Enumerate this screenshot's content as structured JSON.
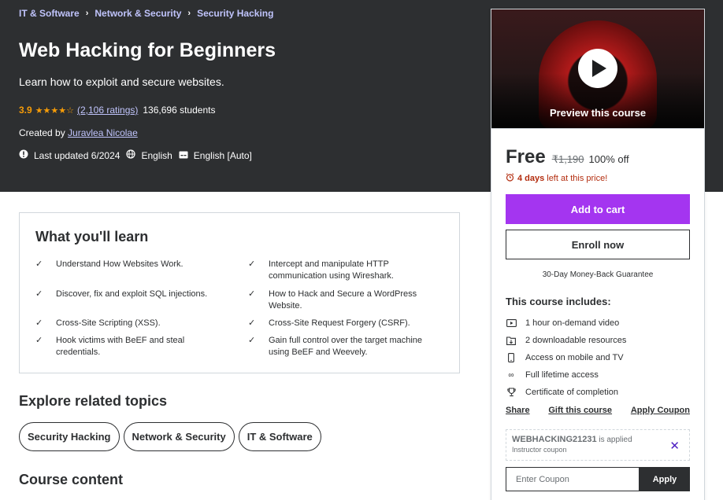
{
  "breadcrumb": [
    "IT & Software",
    "Network & Security",
    "Security Hacking"
  ],
  "course": {
    "title": "Web Hacking for Beginners",
    "subtitle": "Learn how to exploit and secure websites.",
    "rating": "3.9",
    "stars": "★★★★☆",
    "ratings_count": "(2,106 ratings)",
    "students": "136,696 students",
    "created_by_label": "Created by",
    "instructor": "Juravlea Nicolae",
    "last_updated": "Last updated 6/2024",
    "language": "English",
    "captions": "English [Auto]"
  },
  "card": {
    "preview_label": "Preview this course",
    "price": "Free",
    "original_price": "₹1,190",
    "discount": "100% off",
    "countdown_bold": "4 days",
    "countdown_rest": "left at this price!",
    "add_to_cart": "Add to cart",
    "enroll": "Enroll now",
    "guarantee": "30-Day Money-Back Guarantee",
    "includes_title": "This course includes:",
    "includes": [
      {
        "icon": "video-icon",
        "text": "1 hour on-demand video"
      },
      {
        "icon": "file-icon",
        "text": "2 downloadable resources"
      },
      {
        "icon": "mobile-icon",
        "text": "Access on mobile and TV"
      },
      {
        "icon": "infinity-icon",
        "text": "Full lifetime access"
      },
      {
        "icon": "trophy-icon",
        "text": "Certificate of completion"
      }
    ],
    "links": [
      "Share",
      "Gift this course",
      "Apply Coupon"
    ],
    "coupon_code": "WEBHACKING21231",
    "coupon_applied": "is applied",
    "coupon_sub": "Instructor coupon",
    "coupon_placeholder": "Enter Coupon",
    "apply": "Apply"
  },
  "learn": {
    "title": "What you'll learn",
    "items": [
      "Understand How Websites Work.",
      "Intercept and manipulate HTTP communication using Wireshark.",
      "Discover, fix and exploit SQL injections.",
      "How to Hack and Secure a WordPress Website.",
      "Cross-Site Scripting (XSS).",
      "Cross-Site Request Forgery (CSRF).",
      "Hook victims with BeEF and steal credentials.",
      "Gain full control over the target machine using BeEF and Weevely."
    ]
  },
  "related": {
    "title": "Explore related topics",
    "topics": [
      "Security Hacking",
      "Network & Security",
      "IT & Software"
    ]
  },
  "content_title": "Course content",
  "colors": {
    "hero_bg": "#2d2f31",
    "accent_purple": "#a435f0",
    "link_purple": "#c0c4fc",
    "star_orange": "#f69c08",
    "countdown_red": "#b32d0f"
  }
}
